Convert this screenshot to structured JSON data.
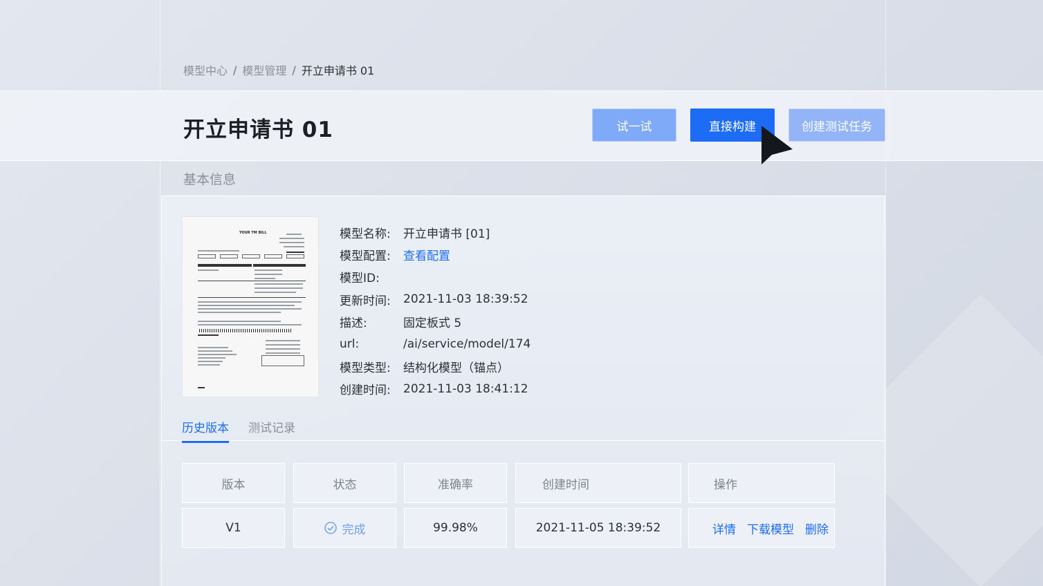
{
  "breadcrumb": {
    "items": [
      "模型中心",
      "模型管理"
    ],
    "separator": "/",
    "current": "开立申请书 01"
  },
  "header": {
    "title": "开立申请书 01",
    "buttons": {
      "try_label": "试一试",
      "build_label": "直接构建",
      "create_test_label": "创建测试任务"
    }
  },
  "section": {
    "basic_info_label": "基本信息"
  },
  "document_preview": {
    "title": "YOUR TM BILL"
  },
  "info": {
    "rows": [
      {
        "label": "模型名称:",
        "value": "开立申请书 [01]"
      },
      {
        "label": "模型配置:",
        "value": "查看配置"
      },
      {
        "label": "模型ID:",
        "value": ""
      },
      {
        "label": "更新时间:",
        "value": "2021-11-03 18:39:52"
      },
      {
        "label": "描述:",
        "value": "固定板式 5"
      },
      {
        "label": "url:",
        "value": "/ai/service/model/174"
      },
      {
        "label": "模型类型:",
        "value": "结构化模型（锚点）"
      },
      {
        "label": "创建时间:",
        "value": "2021-11-03 18:41:12"
      }
    ]
  },
  "tabs": [
    {
      "label": "历史版本",
      "active": true
    },
    {
      "label": "测试记录",
      "active": false
    }
  ],
  "table": {
    "headers": [
      "版本",
      "状态",
      "准确率",
      "创建时间",
      "操作"
    ],
    "rows": [
      {
        "version": "V1",
        "status": "完成",
        "accuracy": "99.98%",
        "created": "2021-11-05 18:39:52",
        "actions": [
          "详情",
          "下载模型",
          "删除"
        ]
      }
    ]
  },
  "colors": {
    "accent": "#1d6cf5",
    "button_light": "#7faaf7",
    "status_done": "#6fa0f2"
  }
}
